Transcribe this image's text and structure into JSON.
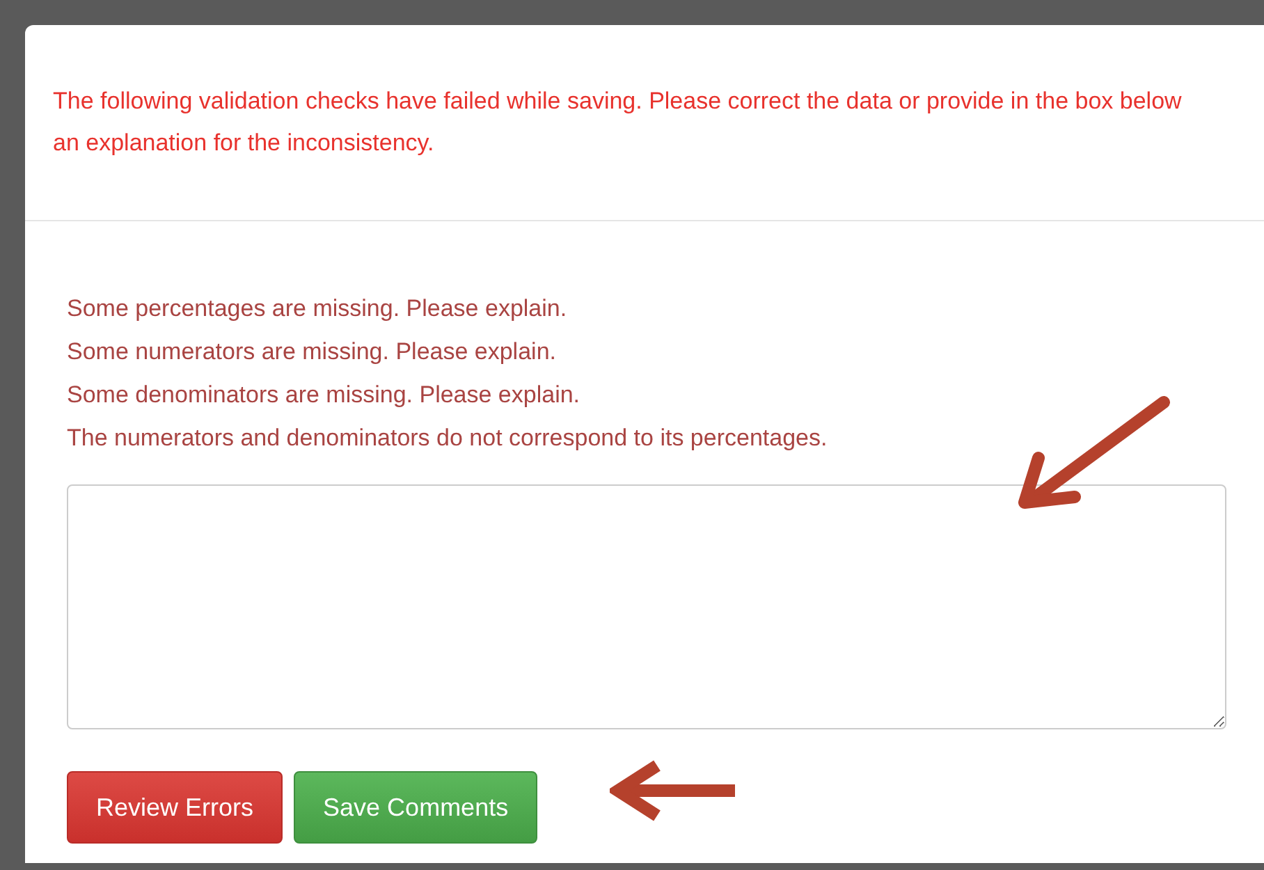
{
  "dialog": {
    "header_message": "The following validation checks have failed while saving. Please correct the data or provide in the box below an explanation for the inconsistency.",
    "errors": [
      "Some percentages are missing. Please explain.",
      "Some numerators are missing. Please explain.",
      "Some denominators are missing. Please explain.",
      "The numerators and denominators do not correspond to its percentages."
    ],
    "buttons": [
      {
        "label": "Review Errors",
        "kind": "danger"
      },
      {
        "label": "Save Comments",
        "kind": "success"
      }
    ]
  }
}
